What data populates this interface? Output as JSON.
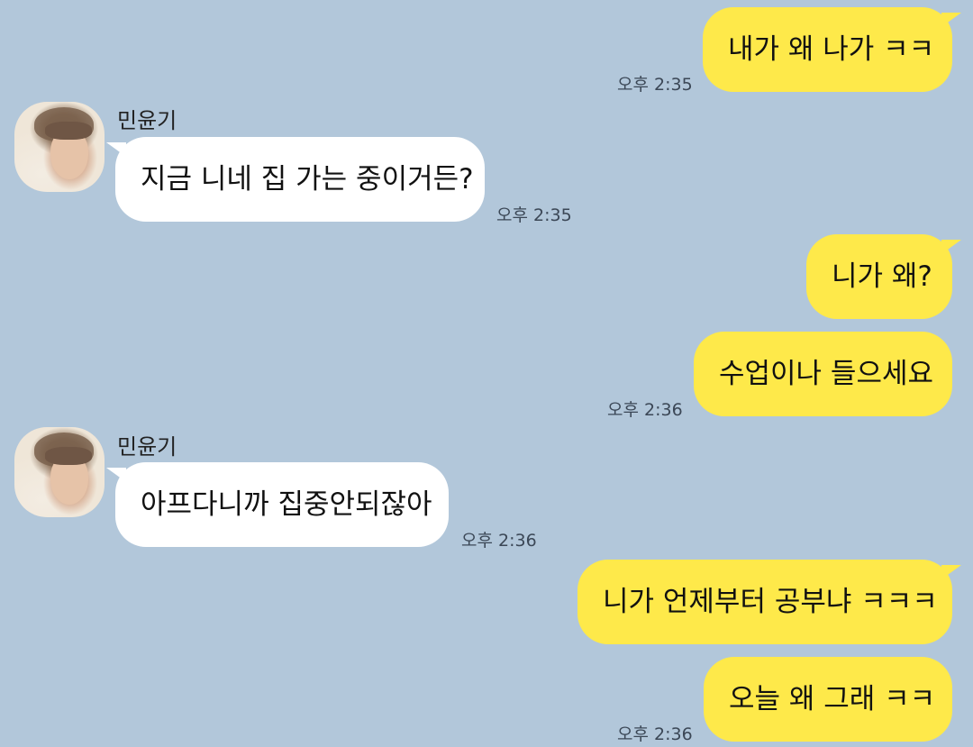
{
  "colors": {
    "background": "#b2c7da",
    "outgoing_bubble": "#fee94a",
    "incoming_bubble": "#ffffff"
  },
  "messages": [
    {
      "direction": "outgoing",
      "text": "내가 왜 나가 ㅋㅋ",
      "time": "오후 2:35"
    },
    {
      "direction": "incoming",
      "sender": "민윤기",
      "text": "지금 니네 집 가는 중이거든?",
      "time": "오후 2:35"
    },
    {
      "direction": "outgoing",
      "text": "니가 왜?",
      "time": ""
    },
    {
      "direction": "outgoing",
      "text": "수업이나 들으세요",
      "time": "오후 2:36"
    },
    {
      "direction": "incoming",
      "sender": "민윤기",
      "text": "아프다니까 집중안되잖아",
      "time": "오후 2:36"
    },
    {
      "direction": "outgoing",
      "text": "니가 언제부터 공부냐 ㅋㅋㅋ",
      "time": ""
    },
    {
      "direction": "outgoing",
      "text": "오늘 왜 그래 ㅋㅋ",
      "time": "오후 2:36"
    }
  ],
  "icons": {
    "avatar": "profile-photo-avatar"
  }
}
